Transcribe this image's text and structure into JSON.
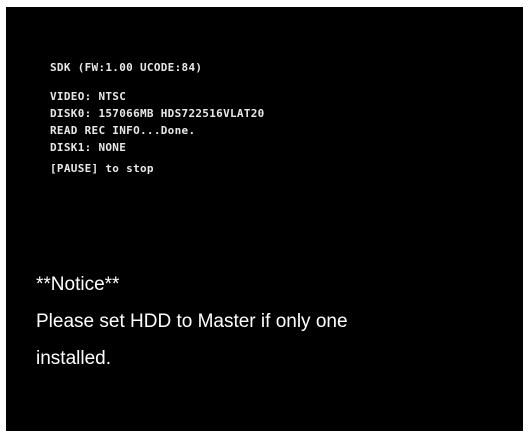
{
  "boot_log": {
    "sdk_line": "SDK (FW:1.00 UCODE:84)",
    "video_line": "VIDEO: NTSC",
    "disk0_line": "DISK0: 157066MB HDS722516VLAT20",
    "read_rec_line": "READ REC INFO...Done.",
    "disk1_line": "DISK1: NONE",
    "pause_line": "[PAUSE] to stop"
  },
  "notice": {
    "heading": "**Notice**",
    "line1": "Please set HDD to Master if only one",
    "line2": "installed."
  },
  "colors": {
    "screen_background": "#000000",
    "log_text": "#e8e8e8",
    "notice_text": "#ffffff"
  }
}
